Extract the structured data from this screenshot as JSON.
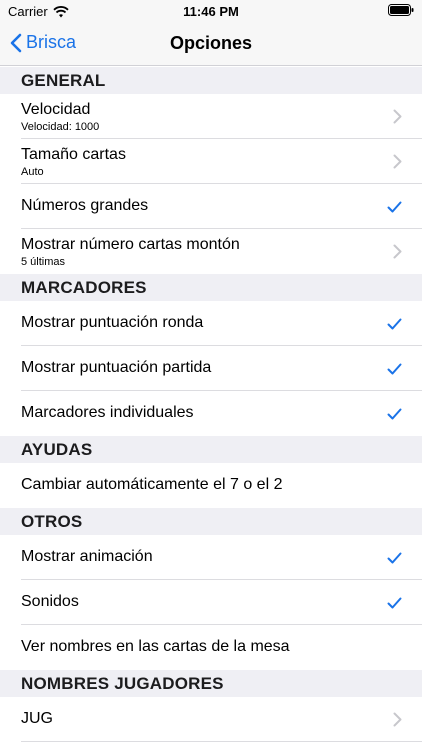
{
  "status": {
    "carrier": "Carrier",
    "time": "11:46 PM"
  },
  "nav": {
    "back_label": "Brisca",
    "title": "Opciones"
  },
  "sections": [
    {
      "header": "GENERAL",
      "rows": [
        {
          "title": "Velocidad",
          "subtitle": "Velocidad: 1000",
          "accessory": "chevron"
        },
        {
          "title": "Tamaño cartas",
          "subtitle": "Auto",
          "accessory": "chevron"
        },
        {
          "title": "Números grandes",
          "accessory": "check"
        },
        {
          "title": "Mostrar número cartas montón",
          "subtitle": "5 últimas",
          "accessory": "chevron"
        }
      ]
    },
    {
      "header": "MARCADORES",
      "rows": [
        {
          "title": "Mostrar puntuación ronda",
          "accessory": "check"
        },
        {
          "title": "Mostrar puntuación partida",
          "accessory": "check"
        },
        {
          "title": "Marcadores individuales",
          "accessory": "check"
        }
      ]
    },
    {
      "header": "AYUDAS",
      "rows": [
        {
          "title": "Cambiar automáticamente el 7 o el 2",
          "accessory": "none"
        }
      ]
    },
    {
      "header": "OTROS",
      "rows": [
        {
          "title": "Mostrar animación",
          "accessory": "check"
        },
        {
          "title": "Sonidos",
          "accessory": "check"
        },
        {
          "title": "Ver nombres en las cartas de la mesa",
          "accessory": "none"
        }
      ]
    },
    {
      "header": "NOMBRES JUGADORES",
      "rows": [
        {
          "title": "JUG",
          "accessory": "chevron"
        }
      ]
    }
  ],
  "colors": {
    "accent": "#1a73e8",
    "chevron": "#c7c7cc",
    "section_bg": "#efeff4"
  }
}
